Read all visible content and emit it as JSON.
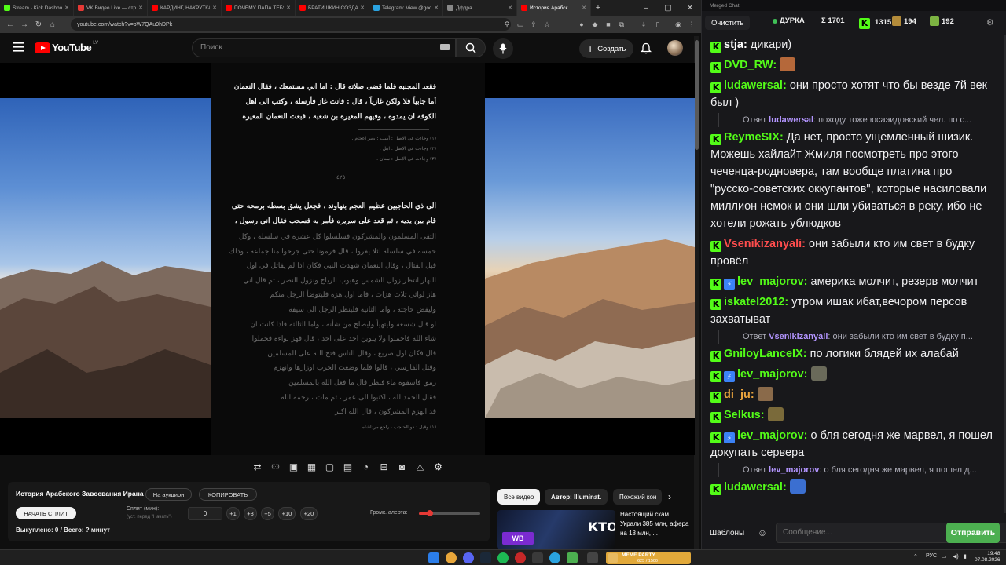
{
  "browser": {
    "tabs": [
      {
        "title": "Stream - Kick Dashboard",
        "color": "#53fc18"
      },
      {
        "title": "VK Видео Live — стрим",
        "color": "#e53935"
      },
      {
        "title": "КАРДИНГ, НАКРУТКА",
        "color": "#ff0000"
      },
      {
        "title": "ПОЧЕМУ ПАПА ТЕБЯ",
        "color": "#ff0000"
      },
      {
        "title": "БРАТИШКИН СОЗДА",
        "color": "#ff0000"
      },
      {
        "title": "Telegram: View @god",
        "color": "#2aa3e0"
      },
      {
        "title": "Дфдра",
        "color": "#888888"
      },
      {
        "title": "История Арабск",
        "color": "#ff0000"
      }
    ],
    "url": "youtube.com/watch?v=bW7QAu9hDPk"
  },
  "youtube": {
    "logo_text": "YouTube",
    "country": "LV",
    "search_placeholder": "Поиск",
    "create_label": "Создать"
  },
  "video": {
    "arabic_top": [
      "فقعد المجنبه فلما قضى صلاته قال : اما اني مستمعك ، فقال النعمان",
      "أما جابياً فلا ولكن غازياً ، قال : فانت غاز فأرسله ، وكتب الى اهل",
      "الكوفة ان يمدوه ، وفيهم المغيرة بن شعبة ، فبعث النعمان المغيرة"
    ],
    "notes": [
      "(١) وجاءت في الاصل : أميب : بغير اعجام .",
      "(٢) وجاءت في الاصل : اهل .",
      "(٣) وجاءت في الاصل : سنان ."
    ],
    "page_number": "٤٢٥",
    "arabic_bright": [
      "الى ذي الحاجبين عظيم العجم بنهاوند ، فجعل يشق بسطه برمحه حتى",
      "قام بين يديه ، ثم قعد على سريره فأمر به فسحب فقال اني رسول ،"
    ],
    "arabic_dim": [
      "التقى المسلمون والمشركون فسلسلوا كل عشرة في سلسلة ، وكل",
      "خمسة في سلسلة لئلا يفروا ، قال فرمونا حتى جرحوا منا جماعة ، وذلك",
      "قبل القتال ، وقال النعمان شهدت النبي فكان اذا لم يقاتل في اول",
      "النهار انتظر زوال الشمس وهبوب الرياح ونزول النصر ، ثم قال اني",
      "هاز لوائي ثلاث هزات ، فاما اول هزة فليتوضأ الرجل منكم",
      "وليقض حاجته ، واما الثانية فلينظر الرجل الى سيفه",
      "او قال شسعه وليتهيأ وليصلح من شأنه ، واما الثالثة فاذا كانت ان",
      "شاء الله فاحملوا ولا يلوين احد على احد ، قال فهز لواءه فحملوا",
      "قال فكان اول صريع ، وقال الناس فتح الله على المسلمين",
      "وقتل الفارسي ، قالوا فلما وضعت الحرب اوزارها وانهزم",
      "رمق فاسقوه ماء فنظر قال ما فعل الله بالمسلمين",
      "فقال الحمد لله ، اكتبوا الى عمر ، ثم مات ، رحمه الله",
      "قد انهزم المشركون ، قال الله اكبر"
    ],
    "footnote": "(١) وقيل : ذو الحاجب ، راجع مرداشاه .",
    "tools": [
      "loop-icon",
      "broadcast-icon",
      "record-icon",
      "clapper-icon",
      "frame-icon",
      "subtitles-icon",
      "speed-icon",
      "add-icon",
      "camera-icon",
      "flask-icon",
      "gear-icon"
    ]
  },
  "panel": {
    "title": "История Арабского Завоевания Ирана",
    "auction_label": "На аукцион",
    "copy_label": "КОПИРОВАТЬ",
    "start_split_label": "НАЧАТЬ СПЛИТ",
    "split_label": "Сплит (мин):",
    "split_hint": "(уст. перед \"Начать\")",
    "split_value": "0",
    "increments": [
      "+1",
      "+3",
      "+5",
      "+10",
      "+20"
    ],
    "volume_label": "Громк. алерта:",
    "volume_level": 0.18,
    "bought_text": "Выкуплено: 0 / Всего: ? минут"
  },
  "recommendations": {
    "chips": [
      "Все видео",
      "Автор: Illuminat.",
      "Похожий кон"
    ],
    "thumb_text": "КТО",
    "video_title": "Настоящий скам. Украли 385 млн, афера на 18 млн, ..."
  },
  "chat": {
    "window_title": "Merged Chat",
    "clear_label": "Очистить",
    "channel": "ДУРКА",
    "total": "Σ 1701",
    "kick_count": "1315",
    "c2_count": "194",
    "c3_count": "192",
    "messages": [
      {
        "user": "stja",
        "color": "#ffffff",
        "vip": false,
        "text": "дикари)",
        "reply": null
      },
      {
        "user": "DVD_RW",
        "color": "#53fc18",
        "vip": false,
        "text": "",
        "emote": "#b5683a",
        "reply": null
      },
      {
        "user": "ludawersal",
        "color": "#53fc18",
        "vip": false,
        "text": "они просто хотят что бы везде 7й век был )",
        "reply": null
      },
      {
        "user": "ReymeSIX",
        "color": "#53fc18",
        "vip": false,
        "text": "Да нет, просто ущемленный шизик. Можешь хайлайт Жмиля посмотреть про этого чеченца-родновера, там вообще платина про \"русско-советских оккупантов\", которые насиловали миллион немок и они шли убиваться в реку, ибо не хотели рожать ублюдков",
        "reply": {
          "user": "ludawersal",
          "text": "походу тоже юсаэидовский чел. по с..."
        }
      },
      {
        "user": "Vsenikizanyali",
        "color": "#ff4d4d",
        "vip": false,
        "text": "они забыли кто им свет в будку провёл",
        "reply": null
      },
      {
        "user": "lev_majorov",
        "color": "#53fc18",
        "vip": true,
        "text": "америка молчит, резерв молчит",
        "reply": null
      },
      {
        "user": "iskatel2012",
        "color": "#53fc18",
        "vip": false,
        "text": "утром ишак ибат,вечором персов захватыват",
        "reply": null
      },
      {
        "user": "GniloyLanceIX",
        "color": "#53fc18",
        "vip": false,
        "text": "по логики блядей их алабай",
        "reply": {
          "user": "Vsenikizanyali",
          "text": "они забыли кто им свет в будку п..."
        }
      },
      {
        "user": "lev_majorov",
        "color": "#53fc18",
        "vip": true,
        "text": "",
        "emote": "#6a6a5a",
        "reply": null
      },
      {
        "user": "di_ju",
        "color": "#e8a33d",
        "vip": false,
        "text": "",
        "emote": "#8a6a4a",
        "reply": null
      },
      {
        "user": "Selkus",
        "color": "#53fc18",
        "vip": false,
        "text": "",
        "emote": "#7a6a3a",
        "reply": null
      },
      {
        "user": "lev_majorov",
        "color": "#53fc18",
        "vip": true,
        "text": "о бля сегодня же марвел, я пошел докупать сервера",
        "reply": null
      },
      {
        "user": "ludawersal",
        "color": "#53fc18",
        "vip": false,
        "text": "",
        "emote": "#3b6fd1",
        "reply": {
          "user": "lev_majorov",
          "text": "о бля сегодня же марвел, я пошел д..."
        }
      }
    ],
    "templates_label": "Шаблоны",
    "input_placeholder": "Сообщение...",
    "send_label": "Отправить"
  },
  "taskbar": {
    "media_title": "MEME PARTY",
    "media_status": "625 / 1500",
    "lang": "РУС",
    "time": "19:48",
    "date": "07.08.2026"
  }
}
